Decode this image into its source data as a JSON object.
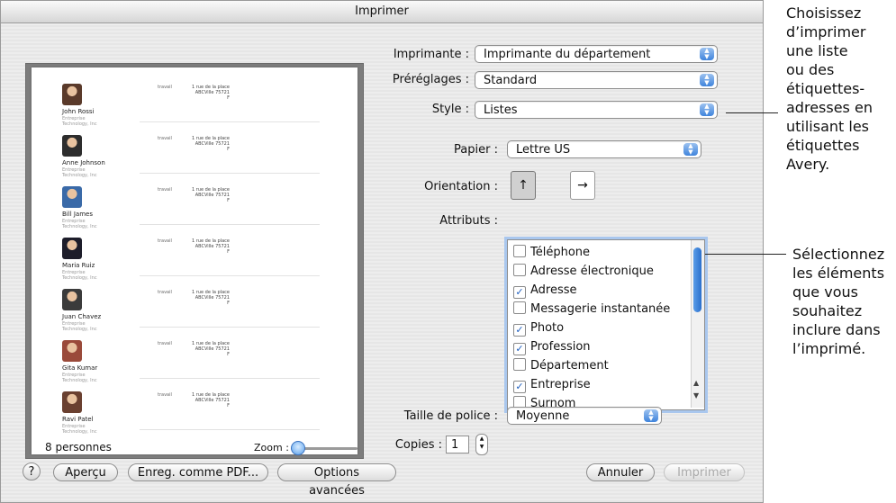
{
  "window": {
    "title": "Imprimer"
  },
  "preview": {
    "entries": [
      {
        "name": "John Rossi",
        "company": "Entreprise",
        "org": "Technology, Inc",
        "label": "travail",
        "addr1": "1 rue de la place",
        "addr2": "ABCVille 75721",
        "addr3": "F",
        "color": "#5a3a2a"
      },
      {
        "name": "Anne Johnson",
        "company": "Entreprise",
        "org": "Technology, Inc",
        "label": "travail",
        "addr1": "1 rue de la place",
        "addr2": "ABCVille 75721",
        "addr3": "F",
        "color": "#2d2d2d"
      },
      {
        "name": "Bill James",
        "company": "Entreprise",
        "org": "Technology, Inc",
        "label": "travail",
        "addr1": "1 rue de la place",
        "addr2": "ABCVille 75721",
        "addr3": "F",
        "color": "#3a6aa8"
      },
      {
        "name": "Maria Ruiz",
        "company": "Entreprise",
        "org": "Technology, Inc",
        "label": "travail",
        "addr1": "1 rue de la place",
        "addr2": "ABCVille 75721",
        "addr3": "F",
        "color": "#1d1d2a"
      },
      {
        "name": "Juan Chavez",
        "company": "Entreprise",
        "org": "Technology, Inc",
        "label": "travail",
        "addr1": "1 rue de la place",
        "addr2": "ABCVille 75721",
        "addr3": "F",
        "color": "#3b3b3b"
      },
      {
        "name": "Gita Kumar",
        "company": "Entreprise",
        "org": "Technology, Inc",
        "label": "travail",
        "addr1": "1 rue de la place",
        "addr2": "ABCVille 75721",
        "addr3": "F",
        "color": "#9a4a3a"
      },
      {
        "name": "Ravi Patel",
        "company": "Entreprise",
        "org": "Technology, Inc",
        "label": "travail",
        "addr1": "1 rue de la place",
        "addr2": "ABCVille 75721",
        "addr3": "F",
        "color": "#6a4030"
      }
    ],
    "count_label": "8 personnes",
    "zoom_label": "Zoom :"
  },
  "form": {
    "printer_label": "Imprimante :",
    "printer_value": "Imprimante du département",
    "presets_label": "Préréglages :",
    "presets_value": "Standard",
    "style_label": "Style :",
    "style_value": "Listes",
    "paper_label": "Papier :",
    "paper_value": "Lettre US",
    "orientation_label": "Orientation :",
    "attributes_label": "Attributs :",
    "attributes": [
      {
        "label": "Téléphone",
        "checked": false
      },
      {
        "label": "Adresse électronique",
        "checked": false
      },
      {
        "label": "Adresse",
        "checked": true
      },
      {
        "label": "Messagerie instantanée",
        "checked": false
      },
      {
        "label": "Photo",
        "checked": true
      },
      {
        "label": "Profession",
        "checked": true
      },
      {
        "label": "Département",
        "checked": false
      },
      {
        "label": "Entreprise",
        "checked": true
      },
      {
        "label": "Surnom",
        "checked": false
      }
    ],
    "font_size_label": "Taille de police :",
    "font_size_value": "Moyenne",
    "copies_label": "Copies :",
    "copies_value": "1"
  },
  "buttons": {
    "help": "?",
    "preview": "Aperçu",
    "save_pdf": "Enreg. comme PDF...",
    "advanced": "Options avancées",
    "cancel": "Annuler",
    "print": "Imprimer"
  },
  "callouts": {
    "top": [
      "Choisissez",
      "d’imprimer",
      "une liste",
      "ou des",
      "étiquettes-",
      "adresses en",
      "utilisant les",
      "étiquettes",
      "Avery."
    ],
    "bottom": [
      "Sélectionnez",
      "les éléments",
      "que vous",
      "souhaitez",
      "inclure dans",
      "l’imprimé."
    ]
  },
  "colors": {
    "accent": "#3f84dc",
    "focus_ring": "#a9c7ee"
  }
}
